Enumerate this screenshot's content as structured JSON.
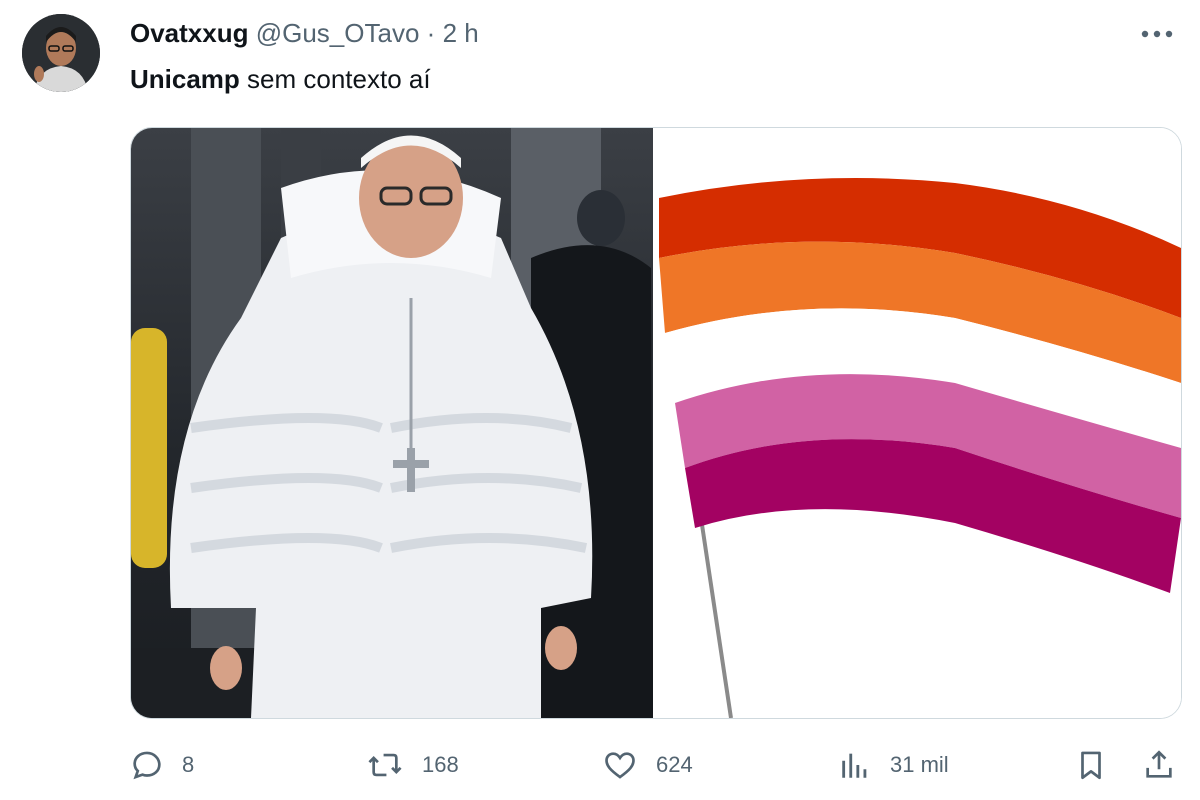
{
  "tweet": {
    "author_name": "Ovatxxug",
    "handle": "@Gus_OTavo",
    "separator": "·",
    "time": "2 h",
    "text_bold": "Unicamp",
    "text_rest": " sem contexto aí"
  },
  "media": {
    "left_image": "man-in-white-puffer-coat-photo",
    "right_image": "lesbian-pride-flag-photo",
    "flag_colors": [
      "#d52d00",
      "#ef7627",
      "#ffffff",
      "#d162a4",
      "#a30262"
    ]
  },
  "actions": {
    "replies": "8",
    "reposts": "168",
    "likes": "624",
    "views": "31 mil"
  },
  "icons": {
    "more": "more-horizontal-icon",
    "reply": "reply-icon",
    "repost": "repost-icon",
    "like": "heart-icon",
    "views": "views-chart-icon",
    "bookmark": "bookmark-icon",
    "share": "share-icon"
  }
}
